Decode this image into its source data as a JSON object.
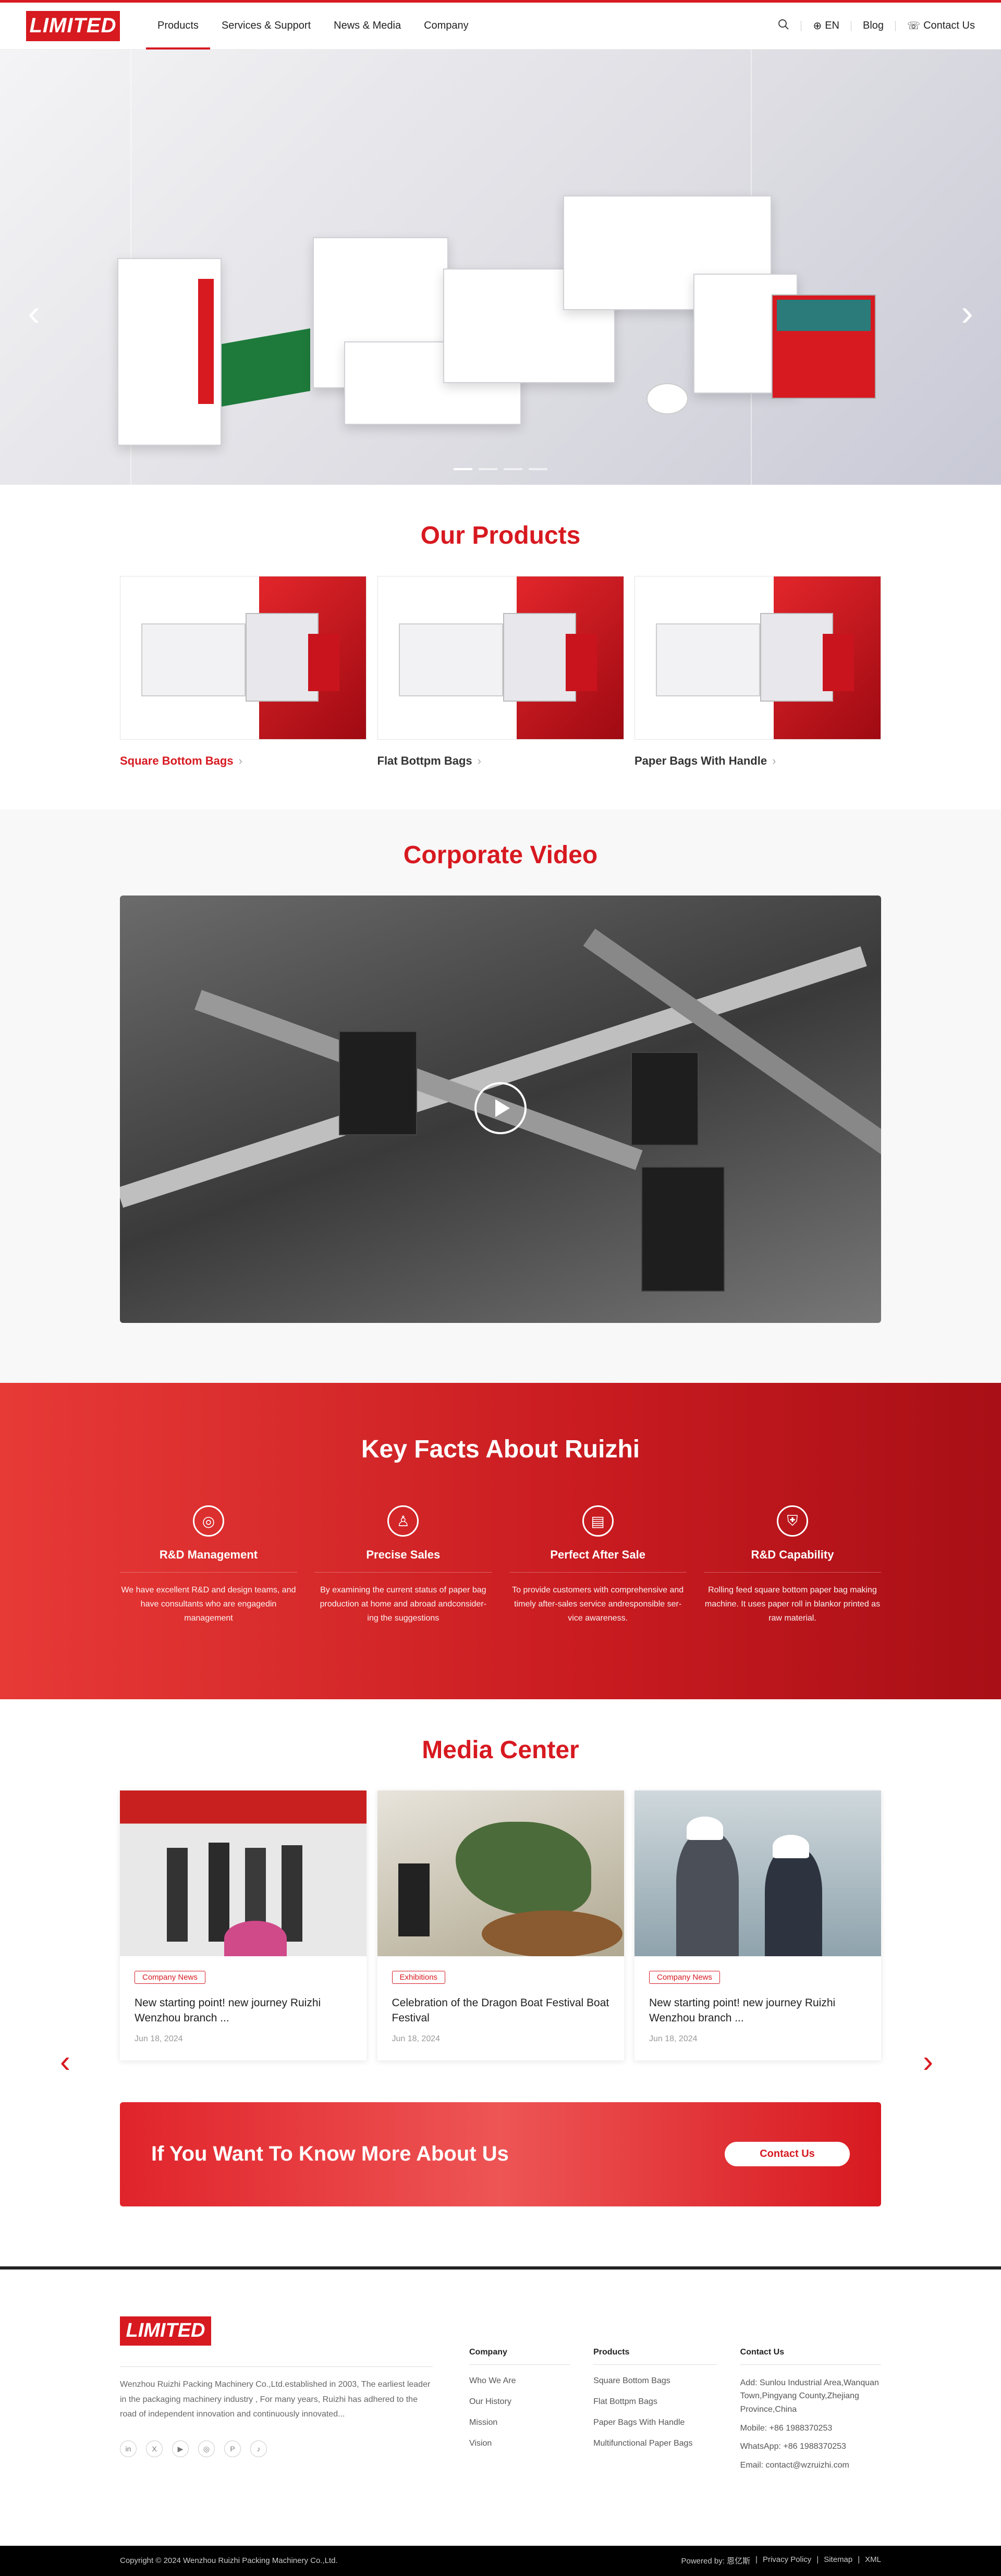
{
  "header": {
    "logo_text": "LIMITED",
    "nav": [
      "Products",
      "Services & Support",
      "News & Media",
      "Company"
    ],
    "lang": "EN",
    "blog": "Blog",
    "contact": "Contact Us"
  },
  "hero": {
    "prev": "‹",
    "next": "›",
    "slides": 4,
    "active_slide": 1
  },
  "products": {
    "title": "Our Products",
    "items": [
      {
        "name": "Square Bottom Bags"
      },
      {
        "name": "Flat Bottpm Bags"
      },
      {
        "name": "Paper Bags With Handle"
      }
    ]
  },
  "video": {
    "title": "Corporate Video"
  },
  "facts": {
    "title": "Key Facts About Ruizhi",
    "items": [
      {
        "icon": "◎",
        "title": "R&D Management",
        "text": "We have excellent R&D and design teams, and have consultants who are engagedin management"
      },
      {
        "icon": "♙",
        "title": "Precise Sales",
        "text": "By examining the current status of paper bag production at home and abroad andconsider-ing the suggestions"
      },
      {
        "icon": "▤",
        "title": "Perfect After Sale",
        "text": "To provide customers with comprehensive and timely after-sales service andresponsible ser-vice awareness."
      },
      {
        "icon": "⛨",
        "title": "R&D Capability",
        "text": "Rolling feed square bottom paper bag making machine. It uses paper roll in blankor printed as raw material."
      }
    ]
  },
  "media": {
    "title": "Media Center",
    "items": [
      {
        "tag": "Company News",
        "title": "New starting point! new journey Ruizhi Wenzhou branch ...",
        "date": "Jun 18, 2024"
      },
      {
        "tag": "Exhibitions",
        "title": "Celebration of the Dragon Boat Festival Boat Festival",
        "date": "Jun 18, 2024"
      },
      {
        "tag": "Company News",
        "title": "New starting point! new journey Ruizhi Wenzhou branch ...",
        "date": "Jun 18, 2024"
      }
    ]
  },
  "cta": {
    "text": "If You Want To Know More About Us",
    "button": "Contact Us"
  },
  "footer": {
    "logo_text": "LIMITED",
    "desc": "Wenzhou Ruizhi Packing Machinery Co.,Ltd.established in 2003, The earliest leader in the packaging machinery industry , For many years, Ruizhi has adhered to the road of independent innovation and continuously innovated...",
    "social": [
      "in",
      "X",
      "▶",
      "◎",
      "P",
      "♪"
    ],
    "company": {
      "title": "Company",
      "links": [
        "Who We Are",
        "Our History",
        "Mission",
        "Vision"
      ]
    },
    "products": {
      "title": "Products",
      "links": [
        "Square Bottom Bags",
        "Flat Bottpm Bags",
        "Paper Bags With Handle",
        "Multifunctional Paper Bags"
      ]
    },
    "contact": {
      "title": "Contact Us",
      "address": "Add: Sunlou Industrial Area,Wanquan Town,Pingyang County,Zhejiang Province,China",
      "mobile": "Mobile: +86 1988370253",
      "whatsapp": "WhatsApp: +86 1988370253",
      "email": "Email: contact@wzruizhi.com"
    },
    "copyright": "Copyright © 2024 Wenzhou Ruizhi Packing Machinery Co.,Ltd.",
    "powered": "Powered by: 恩亿斯",
    "links": [
      "Privacy Policy",
      "Sitemap",
      "XML"
    ]
  }
}
